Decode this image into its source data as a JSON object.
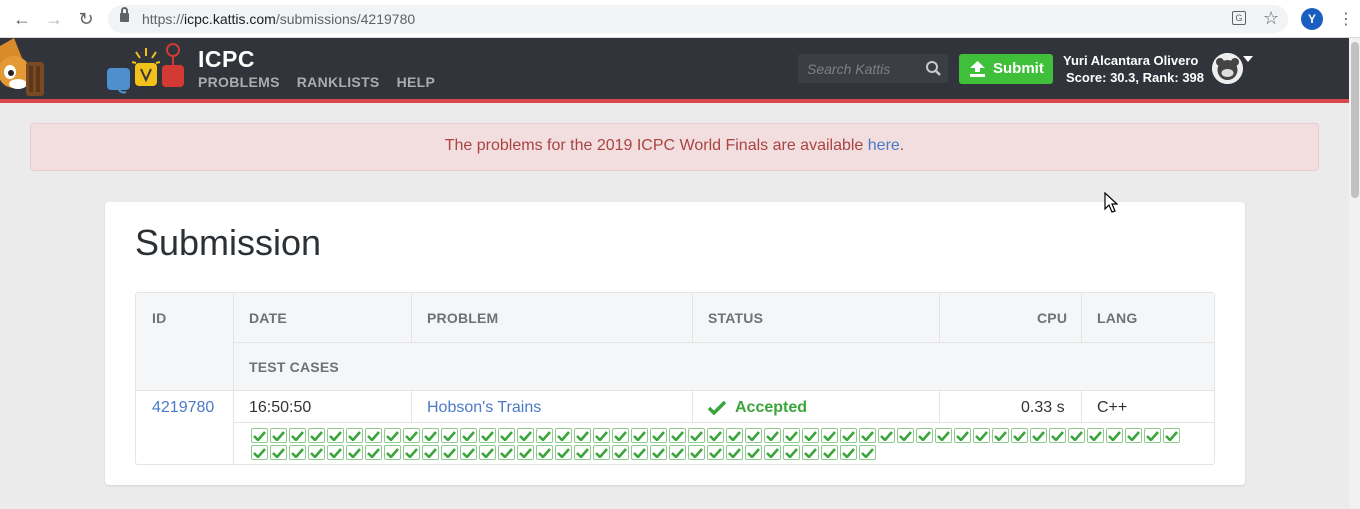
{
  "browser": {
    "url_prefix": "https://",
    "url_host": "icpc.kattis.com",
    "url_path": "/submissions/4219780",
    "profile_initial": "Y"
  },
  "header": {
    "brand": "ICPC",
    "nav": [
      "PROBLEMS",
      "RANKLISTS",
      "HELP"
    ],
    "search_placeholder": "Search Kattis",
    "submit_label": "Submit",
    "user_name": "Yuri Alcantara Olivero",
    "user_score": "Score: 30.3, Rank: 398"
  },
  "alert": {
    "text_before": "The problems for the 2019 ICPC World Finals are available ",
    "link": "here",
    "text_after": "."
  },
  "submission": {
    "title": "Submission",
    "columns": {
      "id": "ID",
      "date": "DATE",
      "problem": "PROBLEM",
      "status": "STATUS",
      "cpu": "CPU",
      "lang": "LANG",
      "test_cases": "TEST CASES"
    },
    "row": {
      "id": "4219780",
      "date": "16:50:50",
      "problem": "Hobson's Trains",
      "status": "Accepted",
      "cpu": "0.33 s",
      "lang": "C++"
    },
    "test_cases_passed": 82,
    "test_cases_per_row": 49
  },
  "colors": {
    "header_bg": "#31343a",
    "accent_red": "#d9494b",
    "submit_green": "#3fbf3a",
    "link_blue": "#4a7ac8",
    "accepted_green": "#3aa53a"
  }
}
